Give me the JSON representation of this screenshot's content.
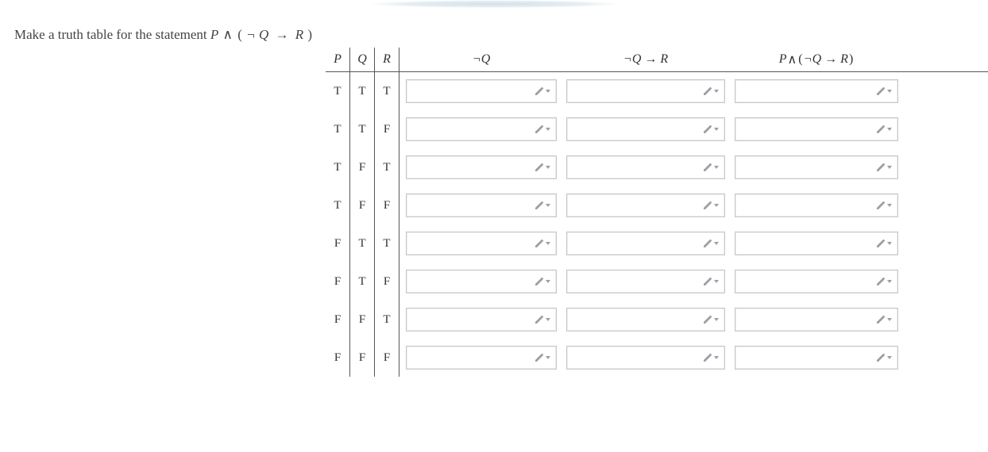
{
  "prompt": {
    "prefix": "Make a truth table for the statement ",
    "P": "P",
    "and": "∧",
    "lpar": "(",
    "neg": "¬",
    "Q": "Q",
    "arrow": "→",
    "R": "R",
    "rpar": ")"
  },
  "headers": {
    "P": "P",
    "Q": "Q",
    "R": "R",
    "col1_neg": "¬",
    "col1_Q": "Q",
    "col2_neg": "¬",
    "col2_Q": "Q",
    "col2_arrow": "→",
    "col2_R": "R",
    "col3_P": "P",
    "col3_and": "∧",
    "col3_lpar": "(",
    "col3_neg": "¬",
    "col3_Q": "Q",
    "col3_arrow": "→",
    "col3_R": "R",
    "col3_rpar": ")"
  },
  "rows": [
    {
      "P": "T",
      "Q": "T",
      "R": "T"
    },
    {
      "P": "T",
      "Q": "T",
      "R": "F"
    },
    {
      "P": "T",
      "Q": "F",
      "R": "T"
    },
    {
      "P": "T",
      "Q": "F",
      "R": "F"
    },
    {
      "P": "F",
      "Q": "T",
      "R": "T"
    },
    {
      "P": "F",
      "Q": "T",
      "R": "F"
    },
    {
      "P": "F",
      "Q": "F",
      "R": "T"
    },
    {
      "P": "F",
      "Q": "F",
      "R": "F"
    }
  ],
  "icons": {
    "pencil_color": "#9aa0a6",
    "arrow_color": "#9aa0a6"
  }
}
